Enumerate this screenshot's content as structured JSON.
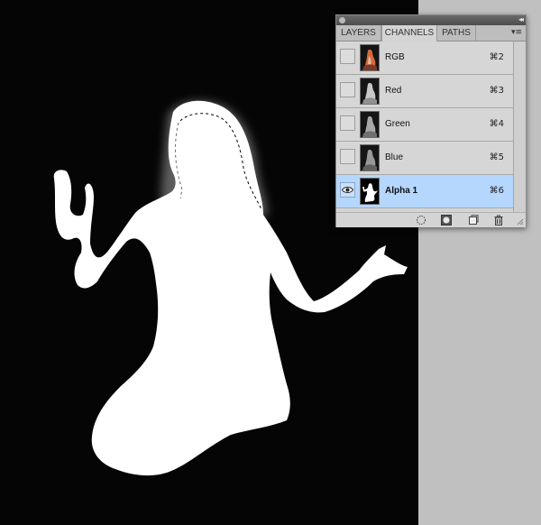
{
  "panel": {
    "tabs": [
      {
        "label": "LAYERS"
      },
      {
        "label": "CHANNELS"
      },
      {
        "label": "PATHS"
      }
    ],
    "menu_icon": "panel-menu-icon",
    "channels": [
      {
        "name": "RGB",
        "shortcut": "⌘2",
        "visible": false,
        "selected": false
      },
      {
        "name": "Red",
        "shortcut": "⌘3",
        "visible": false,
        "selected": false
      },
      {
        "name": "Green",
        "shortcut": "⌘4",
        "visible": false,
        "selected": false
      },
      {
        "name": "Blue",
        "shortcut": "⌘5",
        "visible": false,
        "selected": false
      },
      {
        "name": "Alpha 1",
        "shortcut": "⌘6",
        "visible": true,
        "selected": true
      }
    ],
    "footer_icons": [
      "load-channel-as-selection-icon",
      "save-selection-as-channel-icon",
      "new-channel-icon",
      "delete-channel-icon"
    ]
  },
  "colors": {
    "canvas_background": "#050505",
    "silhouette": "#ffffff",
    "selected_row": "#b5d6fd",
    "pasteboard": "#c0c0c0"
  }
}
